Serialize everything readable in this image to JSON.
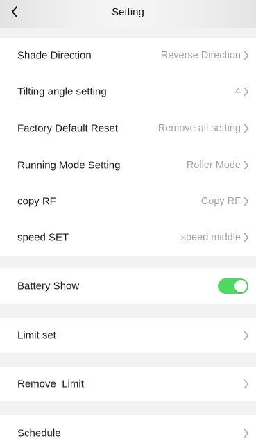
{
  "header": {
    "title": "Setting",
    "back_icon": "chevron-left-icon"
  },
  "colors": {
    "header_bg": "#ececec",
    "separator_bg": "#f2f2f2",
    "value_text": "#a4a4a4",
    "toggle_on": "#4cd964"
  },
  "settings": {
    "shade_direction": {
      "label": "Shade Direction",
      "value": "Reverse Direction"
    },
    "tilting_angle": {
      "label": "Tilting angle setting",
      "value": "4"
    },
    "factory_reset": {
      "label": "Factory Default Reset",
      "value": "Remove all setting"
    },
    "running_mode": {
      "label": "Running Mode Setting",
      "value": "Roller Mode"
    },
    "copy_rf": {
      "label": "copy RF",
      "value": "Copy RF"
    },
    "speed_set": {
      "label": "speed SET",
      "value": "speed middle"
    },
    "battery_show": {
      "label": "Battery Show",
      "enabled": true
    },
    "limit_set": {
      "label": "Limit set"
    },
    "remove_limit": {
      "label": "Remove  Limit"
    },
    "schedule": {
      "label": "Schedule"
    }
  }
}
